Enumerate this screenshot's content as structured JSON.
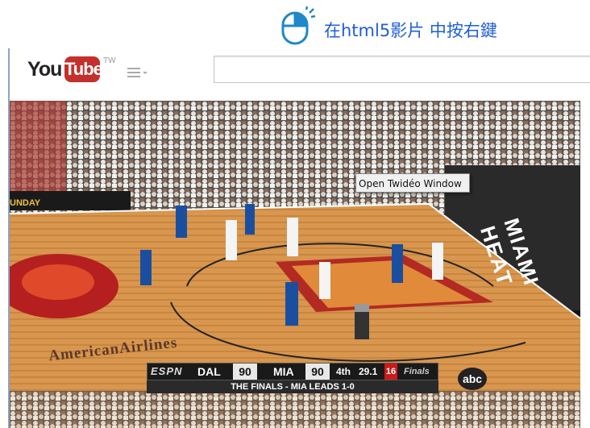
{
  "annotation": {
    "text": "在html5影片 中按右鍵",
    "icon": "mouse-right-click-icon",
    "accent_color": "#1f5fd6",
    "arrow_color": "#cc1111"
  },
  "youtube": {
    "logo_you": "You",
    "logo_tube": "Tube",
    "logo_tm": "TW",
    "guide_icon": "menu-icon",
    "search_placeholder": ""
  },
  "video": {
    "tooltip": "Open Twidéo Window",
    "scoreboard": {
      "network": "ESPN",
      "team1": "DAL",
      "score1": "90",
      "team2": "MIA",
      "score2": "90",
      "quarter": "4th",
      "clock": "29.1",
      "shot_clock": "16",
      "brand": "Finals",
      "banner": "THE FINALS - MIA LEADS 1-0"
    },
    "court_text": {
      "sponsor": "AmericanAirlines",
      "sunday": "UNDAY",
      "heat": "MIAMI HEAT",
      "abc": "abc"
    }
  }
}
